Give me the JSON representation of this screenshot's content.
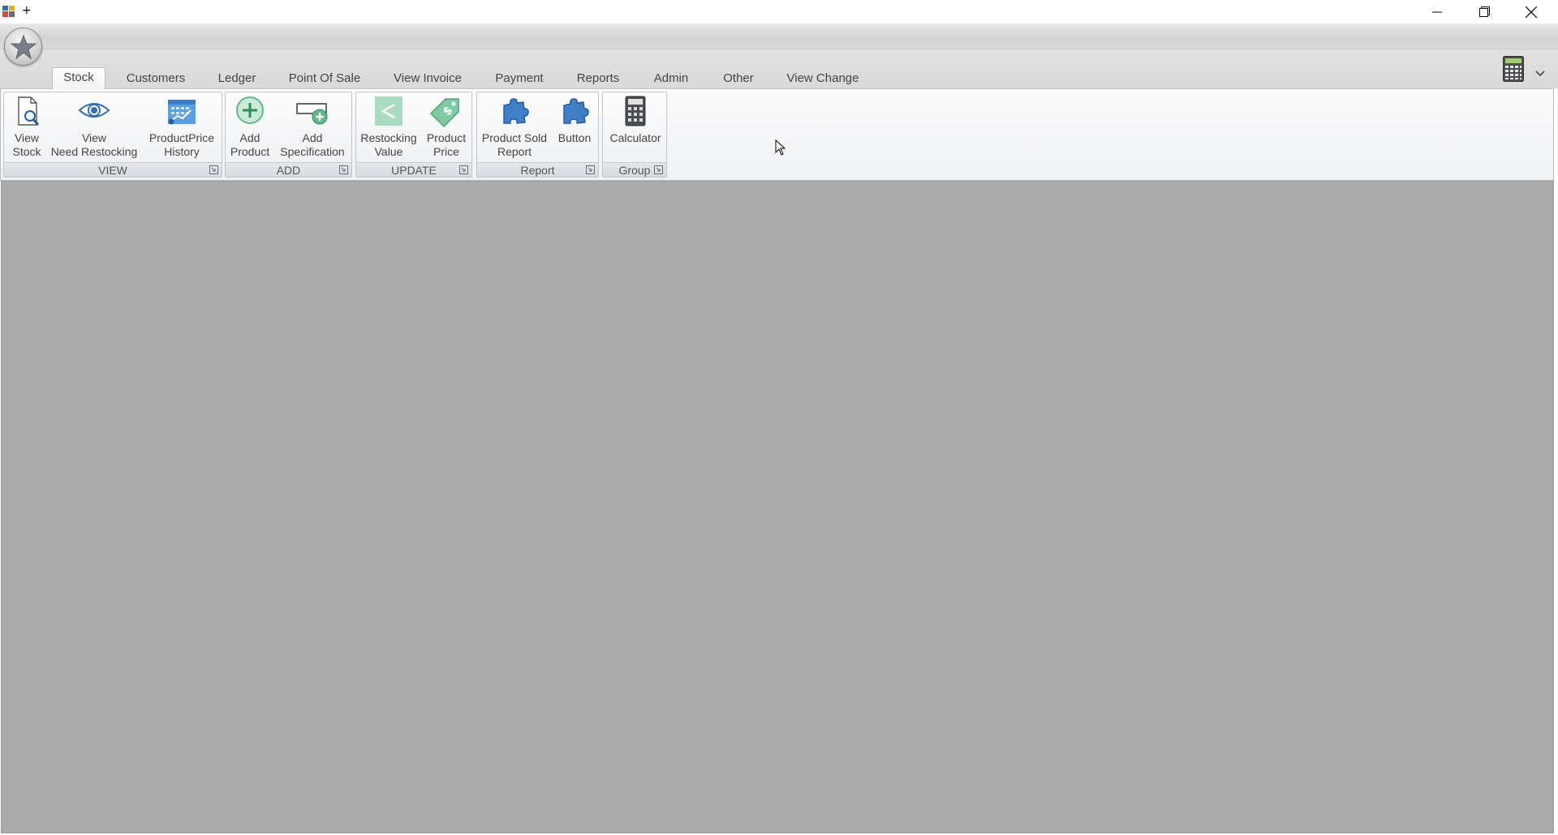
{
  "window": {
    "title": "+",
    "controls": {
      "minimize_icon": "minimize-icon",
      "maximize_icon": "restore-icon",
      "close_icon": "close-icon"
    }
  },
  "tabs": [
    {
      "label": "Stock",
      "active": true
    },
    {
      "label": "Customers"
    },
    {
      "label": "Ledger"
    },
    {
      "label": "Point Of Sale"
    },
    {
      "label": "View Invoice"
    },
    {
      "label": "Payment"
    },
    {
      "label": "Reports"
    },
    {
      "label": "Admin"
    },
    {
      "label": "Other"
    },
    {
      "label": "View Change"
    }
  ],
  "ribbon": {
    "groups": [
      {
        "label": "VIEW",
        "buttons": [
          {
            "label": "View\nStock",
            "icon": "document-magnifier-icon"
          },
          {
            "label": "View\nNeed Restocking",
            "icon": "eye-icon"
          },
          {
            "label": "ProductPrice\nHistory",
            "icon": "calendar-chart-icon"
          }
        ]
      },
      {
        "label": "ADD",
        "buttons": [
          {
            "label": "Add\nProduct",
            "icon": "plus-circle-icon"
          },
          {
            "label": "Add\nSpecification",
            "icon": "add-card-icon"
          }
        ]
      },
      {
        "label": "UPDATE",
        "buttons": [
          {
            "label": "Restocking\nValue",
            "icon": "less-than-icon"
          },
          {
            "label": "Product\nPrice",
            "icon": "price-tag-icon"
          }
        ]
      },
      {
        "label": "Report",
        "buttons": [
          {
            "label": "Product Sold\nReport",
            "icon": "puzzle-icon"
          },
          {
            "label": "Button",
            "icon": "puzzle-icon"
          }
        ]
      },
      {
        "label": "Group",
        "buttons": [
          {
            "label": "Calculator",
            "icon": "calculator-icon"
          }
        ]
      }
    ]
  },
  "colors": {
    "workspace": "#ababab",
    "ribbon": "#f4f5f7",
    "accent_blue": "#2f7bc4",
    "accent_green": "#5fb98a"
  }
}
